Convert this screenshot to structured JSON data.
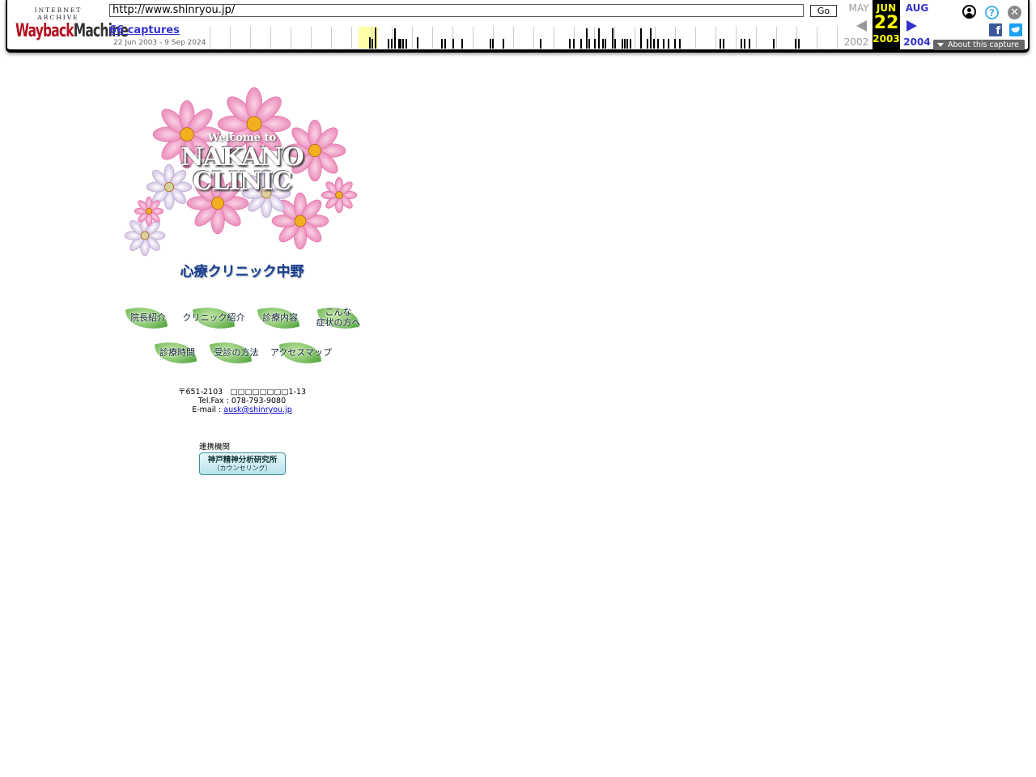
{
  "wayback": {
    "logo_top": "INTERNET ARCHIVE",
    "logo_wayback": "Wayback",
    "logo_machine": "Machine",
    "url": "http://www.shinryou.jp/",
    "go_label": "Go",
    "captures_label": "66 captures",
    "date_range": "22 Jun 2003 - 9 Sep 2024",
    "prev_month": "MAY",
    "prev_year": "2002",
    "cur_month": "JUN",
    "cur_day": "22",
    "cur_year": "2003",
    "next_month": "AUG",
    "next_year": "2004",
    "about_label": "About this capture",
    "help_glyph": "?",
    "close_glyph": "✕",
    "fb_glyph": "f"
  },
  "page": {
    "hero_welcome": "Welcome to",
    "hero_title_line1": "NAKANO",
    "hero_title_line2": "CLINIC",
    "hero_subtitle": "心療クリニック中野",
    "nav": [
      {
        "label": "院長紹介"
      },
      {
        "label": "クリニック紹介"
      },
      {
        "label": "診療内容"
      },
      {
        "label": "こんな\n症状の方へ"
      },
      {
        "label": "診療時間"
      },
      {
        "label": "受診の方法"
      },
      {
        "label": "アクセスマップ"
      }
    ],
    "address_line": "〒651-2103　□□□□□□□□1-13",
    "telfax": "Tel.Fax : 078-793-9080",
    "email_label": "E-mail : ",
    "email": "ausk@shinryou.jp",
    "partner_label": "連携機関",
    "partner_name": "神戸精神分析研究所",
    "partner_sub": "（カウンセリング）"
  }
}
